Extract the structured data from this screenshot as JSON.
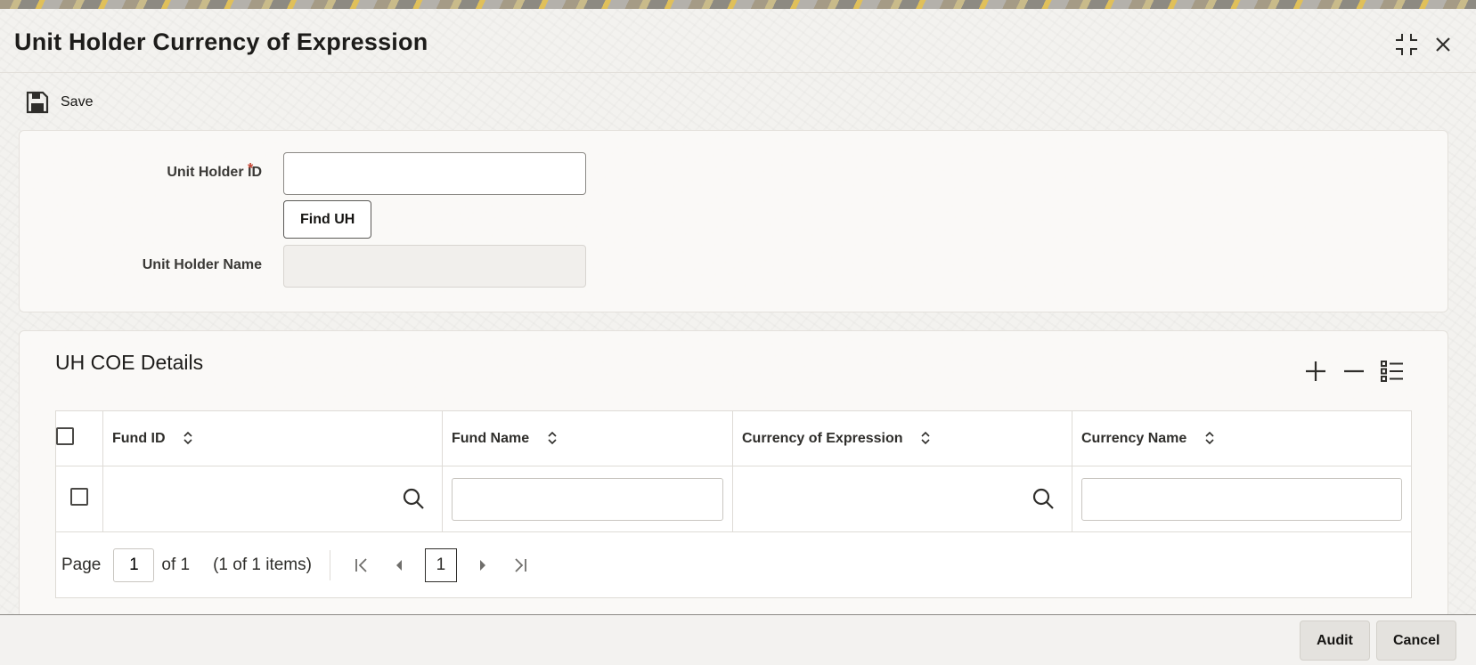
{
  "window": {
    "title": "Unit Holder Currency of Expression",
    "icons": {
      "restore": "collapse-window-icon",
      "close": "close-icon"
    }
  },
  "toolbar": {
    "save_label": "Save",
    "save_icon": "floppy-disk-icon"
  },
  "form": {
    "unit_holder_id": {
      "label": "Unit Holder ID",
      "required_marker": "*",
      "value": ""
    },
    "find_button_label": "Find UH",
    "unit_holder_name": {
      "label": "Unit Holder Name",
      "value": ""
    }
  },
  "grid": {
    "section_title": "UH COE Details",
    "actions": [
      "add-icon",
      "remove-icon",
      "column-list-icon"
    ],
    "columns": [
      {
        "label": "Fund ID",
        "sortable": true
      },
      {
        "label": "Fund Name",
        "sortable": true
      },
      {
        "label": "Currency of Expression",
        "sortable": true
      },
      {
        "label": "Currency Name",
        "sortable": true
      }
    ],
    "rows": [
      {
        "fund_id": "",
        "fund_name": "",
        "currency_of_expression": "",
        "currency_name": ""
      }
    ],
    "pager": {
      "page_label": "Page",
      "current_page": "1",
      "of_label": "of 1",
      "items_label": "(1 of 1 items)",
      "page_button": "1"
    }
  },
  "footer": {
    "audit_label": "Audit",
    "cancel_label": "Cancel"
  },
  "colors": {
    "required": "#c74634",
    "text": "#161513",
    "panel": "#faf9f7",
    "button_secondary": "#e4e2de"
  }
}
